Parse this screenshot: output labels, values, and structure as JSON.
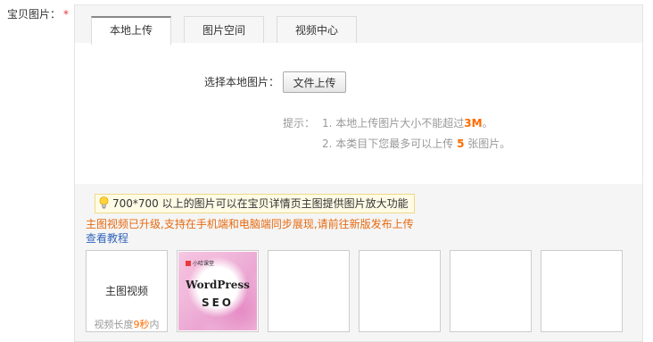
{
  "field": {
    "label": "宝贝图片：",
    "required_mark": "*"
  },
  "tabs": [
    {
      "label": "本地上传",
      "active": true
    },
    {
      "label": "图片空间",
      "active": false
    },
    {
      "label": "视频中心",
      "active": false
    }
  ],
  "local_upload": {
    "choose_label": "选择本地图片：",
    "upload_button": "文件上传",
    "tips_label": "提示：",
    "tip1": {
      "prefix": "1. 本地上传图片大小不能超过",
      "highlight": "3M",
      "suffix": "。"
    },
    "tip2": {
      "prefix": "2. 本类目下您最多可以上传 ",
      "highlight": "5",
      "suffix": " 张图片。"
    }
  },
  "notice": {
    "icon": "lightbulb-icon",
    "text": "700*700 以上的图片可以在宝贝详情页主图提供图片放大功能"
  },
  "video_upgrade_text": "主图视频已升级,支持在手机端和电脑端同步展现,请前往新版发布上传",
  "tutorial_link": "查看教程",
  "video_slot": {
    "title": "主图视频",
    "duration_prefix": "视频长度",
    "duration_value": "9秒",
    "duration_suffix": "内"
  },
  "image_slots": [
    {
      "filled": true,
      "logo_text": "小哈课堂",
      "title": "WordPress",
      "subtitle": "SEO"
    },
    {
      "filled": false
    },
    {
      "filled": false
    },
    {
      "filled": false
    },
    {
      "filled": false
    }
  ],
  "colors": {
    "required": "#e4393c",
    "highlight": "#ff6a00",
    "link": "#3366bb",
    "upgrade_text": "#e66a10"
  }
}
